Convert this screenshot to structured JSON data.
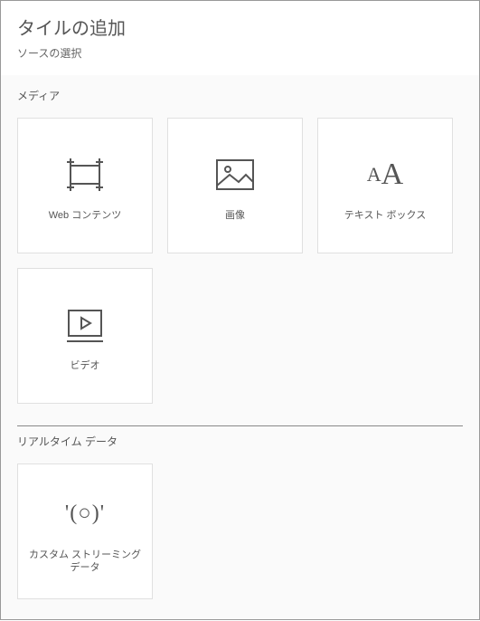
{
  "header": {
    "title": "タイルの追加",
    "subtitle": "ソースの選択"
  },
  "sections": {
    "media": {
      "label": "メディア",
      "tiles": {
        "web": "Web コンテンツ",
        "image": "画像",
        "text": "テキスト ボックス",
        "video": "ビデオ"
      }
    },
    "realtime": {
      "label": "リアルタイム データ",
      "tiles": {
        "streaming": "カスタム ストリーミング データ"
      }
    }
  }
}
